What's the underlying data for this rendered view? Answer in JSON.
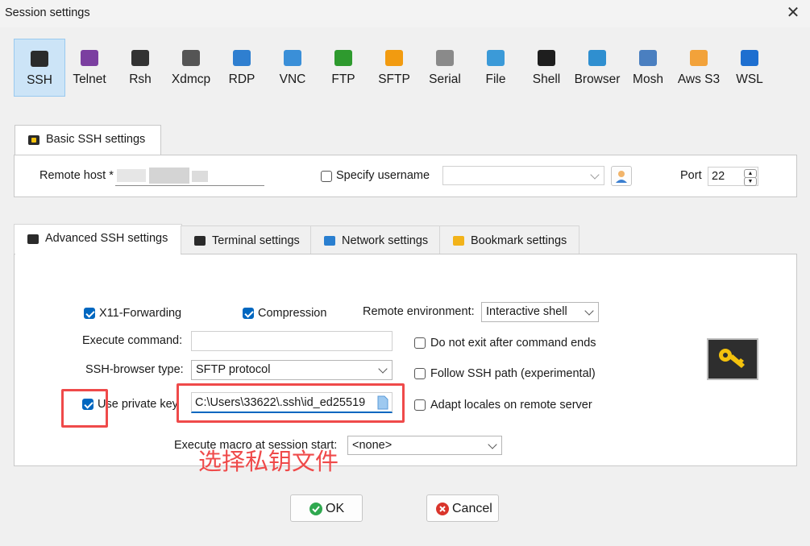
{
  "window": {
    "title": "Session settings",
    "close_glyph": "✕"
  },
  "protocols": [
    {
      "label": "SSH",
      "icon": "ssh-key-icon",
      "color": "#2b2b2b",
      "selected": true
    },
    {
      "label": "Telnet",
      "icon": "telnet-icon",
      "color": "#7b3fa0"
    },
    {
      "label": "Rsh",
      "icon": "rsh-icon",
      "color": "#333333"
    },
    {
      "label": "Xdmcp",
      "icon": "xdmcp-icon",
      "color": "#555555"
    },
    {
      "label": "RDP",
      "icon": "rdp-icon",
      "color": "#2f7fd0"
    },
    {
      "label": "VNC",
      "icon": "vnc-icon",
      "color": "#3a8fd8"
    },
    {
      "label": "FTP",
      "icon": "ftp-globe-icon",
      "color": "#2e9a2e"
    },
    {
      "label": "SFTP",
      "icon": "sftp-globe-icon",
      "color": "#f29b10"
    },
    {
      "label": "Serial",
      "icon": "serial-plug-icon",
      "color": "#8a8a8a"
    },
    {
      "label": "File",
      "icon": "file-explorer-icon",
      "color": "#3b9ad8"
    },
    {
      "label": "Shell",
      "icon": "shell-terminal-icon",
      "color": "#1e1e1e"
    },
    {
      "label": "Browser",
      "icon": "browser-globe-icon",
      "color": "#2f8fd0"
    },
    {
      "label": "Mosh",
      "icon": "mosh-antenna-icon",
      "color": "#4a7fc0"
    },
    {
      "label": "Aws S3",
      "icon": "aws-s3-cubes-icon",
      "color": "#f2a23a"
    },
    {
      "label": "WSL",
      "icon": "wsl-windows-icon",
      "color": "#1e6fd0"
    }
  ],
  "basic": {
    "tab_label": "Basic SSH settings",
    "remote_host_label": "Remote host *",
    "remote_host_value": "",
    "specify_username_label": "Specify username",
    "specify_username_checked": false,
    "username_value": "",
    "port_label": "Port",
    "port_value": "22"
  },
  "tabs": [
    {
      "label": "Advanced SSH settings",
      "icon": "ssh-key-icon",
      "active": true
    },
    {
      "label": "Terminal settings",
      "icon": "terminal-icon"
    },
    {
      "label": "Network settings",
      "icon": "network-icon"
    },
    {
      "label": "Bookmark settings",
      "icon": "star-icon"
    }
  ],
  "advanced": {
    "x11_label": "X11-Forwarding",
    "x11_checked": true,
    "compression_label": "Compression",
    "compression_checked": true,
    "remote_env_label": "Remote environment:",
    "remote_env_value": "Interactive shell",
    "exec_cmd_label": "Execute command:",
    "exec_cmd_value": "",
    "no_exit_label": "Do not exit after command ends",
    "no_exit_checked": false,
    "browser_type_label": "SSH-browser type:",
    "browser_type_value": "SFTP protocol",
    "follow_path_label": "Follow SSH path (experimental)",
    "follow_path_checked": false,
    "private_key_label": "Use private key",
    "private_key_checked": true,
    "private_key_value": "C:\\Users\\33622\\.ssh\\id_ed25519",
    "adapt_locales_label": "Adapt locales on remote server",
    "adapt_locales_checked": false,
    "macro_label": "Execute macro at session start:",
    "macro_value": "<none>"
  },
  "annotation": {
    "text": "选择私钥文件",
    "color": "#ef4a4a"
  },
  "buttons": {
    "ok_label": "OK",
    "cancel_label": "Cancel"
  }
}
